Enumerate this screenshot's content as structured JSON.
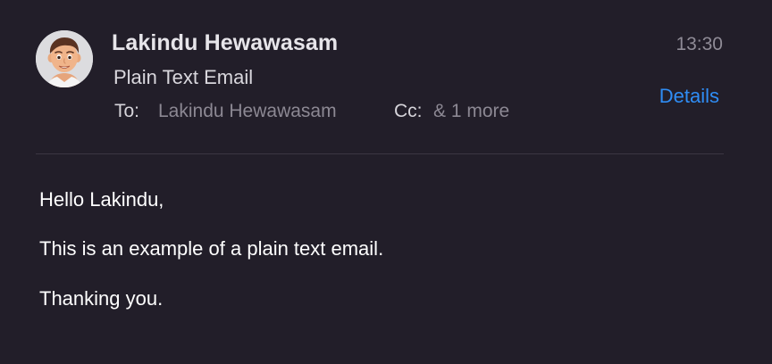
{
  "header": {
    "sender_name": "Lakindu Hewawasam",
    "time": "13:30",
    "subject": "Plain Text Email",
    "details_label": "Details",
    "to_label": "To:",
    "to_value": "Lakindu Hewawasam",
    "cc_label": "Cc:",
    "cc_value": "& 1 more"
  },
  "avatar": {
    "icon": "memoji-avatar-icon",
    "background": "#dcdcdf"
  },
  "body": {
    "lines": [
      "Hello Lakindu,",
      "This is an example of a plain text email.",
      "Thanking you."
    ]
  },
  "colors": {
    "background": "#221e29",
    "accent": "#2f8df5",
    "divider": "#3b3642"
  }
}
